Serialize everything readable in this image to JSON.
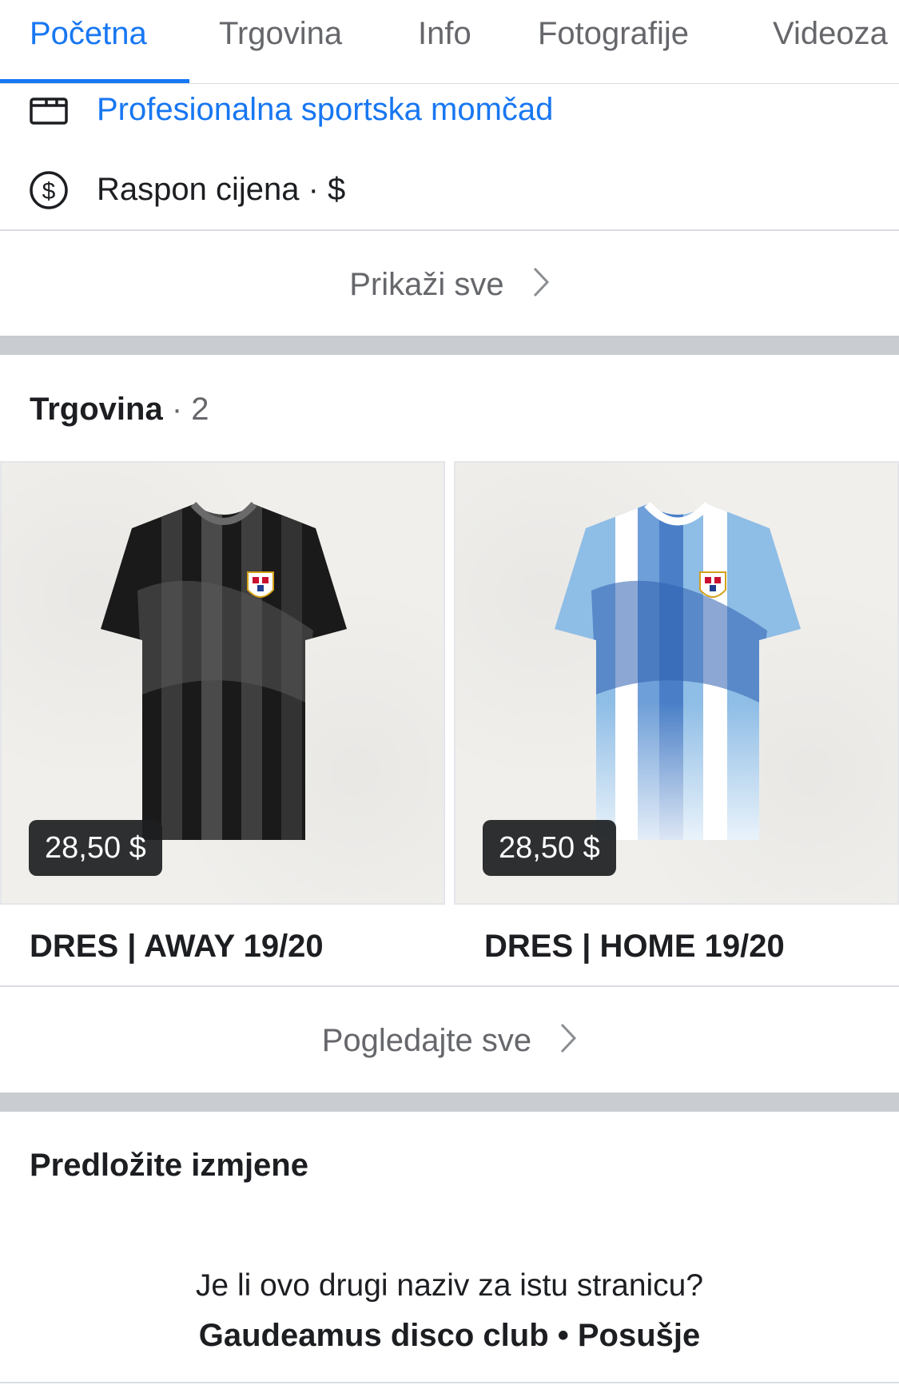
{
  "tabs": [
    {
      "label": "Početna",
      "active": true
    },
    {
      "label": "Trgovina",
      "active": false
    },
    {
      "label": "Info",
      "active": false
    },
    {
      "label": "Fotografije",
      "active": false
    },
    {
      "label": "Videoza",
      "active": false
    }
  ],
  "colors": {
    "accent": "#1877f2",
    "muted": "#65676b",
    "text": "#1c1e21",
    "separator": "#c9ccd1"
  },
  "info": {
    "category": {
      "icon": "category-folder-icon",
      "text": "Profesionalna sportska momčad"
    },
    "price_range": {
      "icon": "dollar-circle-icon",
      "text": "Raspon cijena · $"
    },
    "see_all_label": "Prikaži sve"
  },
  "shop": {
    "title": "Trgovina",
    "count": "· 2",
    "products": [
      {
        "name": "DRES | AWAY 19/20",
        "price": "28,50 $",
        "image": "black-jersey"
      },
      {
        "name": "DRES | HOME 19/20",
        "price": "28,50 $",
        "image": "blue-white-jersey"
      }
    ],
    "view_all_label": "Pogledajte sve"
  },
  "suggest": {
    "title": "Predložite izmjene",
    "question": "Je li ovo drugi naziv za istu stranicu?",
    "alt_name": "Gaudeamus disco club • Posušje"
  }
}
